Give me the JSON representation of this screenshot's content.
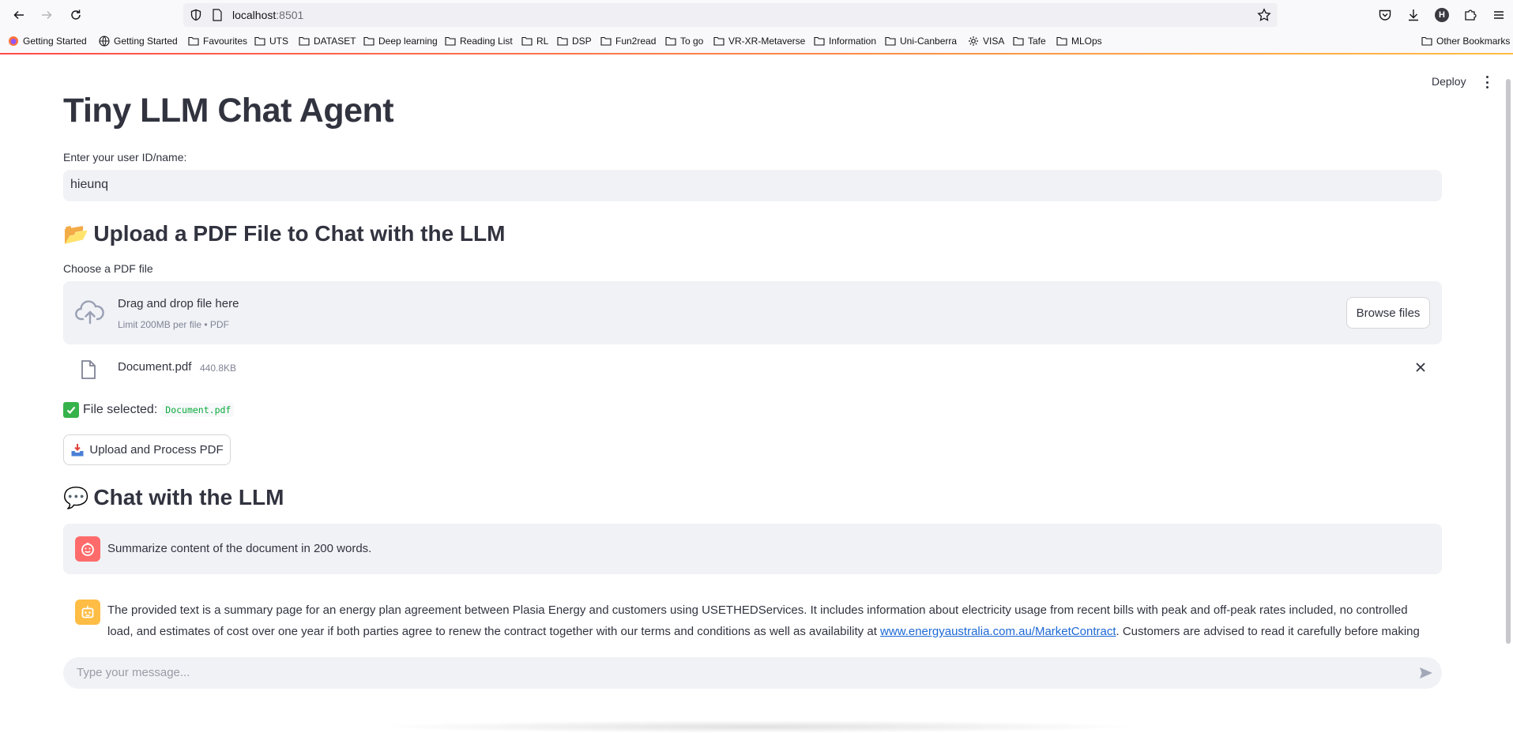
{
  "browser": {
    "url_host": "localhost",
    "url_port": ":8501",
    "bookmarks": [
      {
        "label": "Getting Started",
        "icon": "firefox-icon"
      },
      {
        "label": "Getting Started",
        "icon": "globe-icon"
      },
      {
        "label": "Favourites",
        "icon": "folder-icon"
      },
      {
        "label": "UTS",
        "icon": "folder-icon"
      },
      {
        "label": "DATASET",
        "icon": "folder-icon"
      },
      {
        "label": "Deep learning",
        "icon": "folder-icon"
      },
      {
        "label": "Reading List",
        "icon": "folder-icon"
      },
      {
        "label": "RL",
        "icon": "folder-icon"
      },
      {
        "label": "DSP",
        "icon": "folder-icon"
      },
      {
        "label": "Fun2read",
        "icon": "folder-icon"
      },
      {
        "label": "To go",
        "icon": "folder-icon"
      },
      {
        "label": "VR-XR-Metaverse",
        "icon": "folder-icon"
      },
      {
        "label": "Information",
        "icon": "folder-icon"
      },
      {
        "label": "Uni-Canberra",
        "icon": "folder-icon"
      },
      {
        "label": "VISA",
        "icon": "gear-icon"
      },
      {
        "label": "Tafe",
        "icon": "folder-icon"
      },
      {
        "label": "MLOps",
        "icon": "folder-icon"
      }
    ],
    "other_bookmarks": "Other Bookmarks",
    "profile_initial": "H"
  },
  "app": {
    "deploy_label": "Deploy",
    "title": "Tiny LLM Chat Agent",
    "user_label": "Enter your user ID/name:",
    "user_value": "hieunq",
    "upload_heading_emoji": "📂",
    "upload_heading": "Upload a PDF File to Chat with the LLM",
    "uploader_label": "Choose a PDF file",
    "dropzone_main": "Drag and drop file here",
    "dropzone_sub": "Limit 200MB per file • PDF",
    "browse_label": "Browse files",
    "file_name": "Document.pdf",
    "file_size": "440.8KB",
    "selected_label": "File selected:",
    "selected_code": "Document.pdf",
    "process_button": "Upload and Process PDF",
    "chat_heading_emoji": "💬",
    "chat_heading": "Chat with the LLM",
    "user_message": "Summarize content of the document in 200 words.",
    "bot_message_before_link": "The provided text is a summary page for an energy plan agreement between Plasia Energy and customers using USETHEDServices. It includes information about electricity usage from recent bills with peak and off-peak rates included, no controlled load, and estimates of cost over one year if both parties agree to renew the contract together with our terms and conditions as well as availability at ",
    "bot_message_link": "www.energyaustralia.com.au/MarketContract",
    "bot_message_after_link": ". Customers are advised to read it carefully before making any",
    "chat_placeholder": "Type your message..."
  },
  "colors": {
    "accent": "#ff4b4b",
    "user_avatar": "#ff6b6b",
    "bot_avatar": "#ffbd45",
    "code_text": "#09ab3b",
    "link": "#1c68d5"
  }
}
